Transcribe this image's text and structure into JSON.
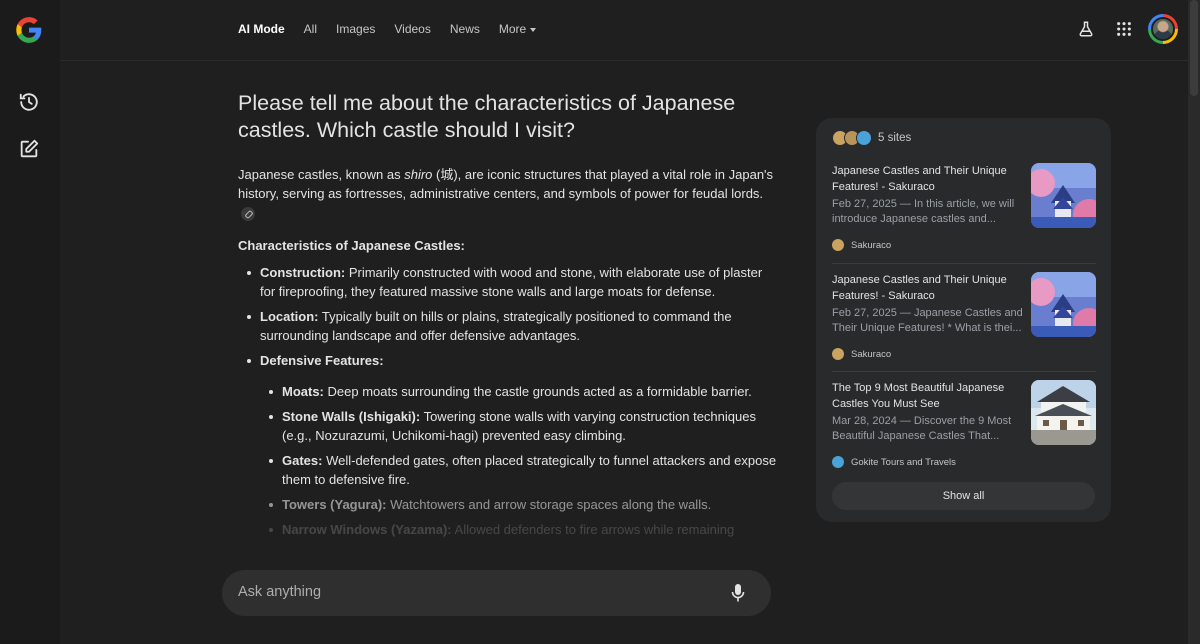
{
  "nav": {
    "tabs": [
      {
        "label": "AI Mode"
      },
      {
        "label": "All"
      },
      {
        "label": "Images"
      },
      {
        "label": "Videos"
      },
      {
        "label": "News"
      },
      {
        "label": "More"
      }
    ],
    "icons": [
      "labs-flask-icon",
      "apps-grid-icon",
      "account-avatar"
    ]
  },
  "sidebar": {
    "icons": [
      "google-logo",
      "history-icon",
      "new-chat-icon"
    ]
  },
  "question": "Please tell me about the characteristics of Japanese castles. Which castle should I visit?",
  "answer": {
    "intro_pre": "Japanese castles, known as ",
    "intro_italic": "shiro",
    "intro_post": " (城), are iconic structures that played a vital role in Japan's history, serving as fortresses, administrative centers, and symbols of power for feudal lords.",
    "section_title": "Characteristics of Japanese Castles:",
    "items": [
      {
        "term": "Construction:",
        "text": " Primarily constructed with wood and stone, with elaborate use of plaster for fireproofing, they featured massive stone walls and large moats for defense."
      },
      {
        "term": "Location:",
        "text": " Typically built on hills or plains, strategically positioned to command the surrounding landscape and offer defensive advantages."
      },
      {
        "term": "Defensive Features:",
        "text": ""
      }
    ],
    "sub_items": [
      {
        "term": "Moats:",
        "text": " Deep moats surrounding the castle grounds acted as a formidable barrier."
      },
      {
        "term": "Stone Walls (Ishigaki):",
        "text": " Towering stone walls with varying construction techniques (e.g., Nozurazumi, Uchikomi-hagi) prevented easy climbing."
      },
      {
        "term": "Gates:",
        "text": " Well-defended gates, often placed strategically to funnel attackers and expose them to defensive fire."
      },
      {
        "term": "Towers (Yagura):",
        "text": " Watchtowers and arrow storage spaces along the walls."
      },
      {
        "term": "Narrow Windows (Yazama):",
        "text": " Allowed defenders to fire arrows while remaining"
      }
    ]
  },
  "ask": {
    "placeholder": "Ask anything"
  },
  "sources": {
    "count_label": "5 sites",
    "items": [
      {
        "title": "Japanese Castles and Their Unique Features! - Sakuraco",
        "snippet": "Feb 27, 2025 — In this article, we will introduce Japanese castles and...",
        "site": "Sakuraco"
      },
      {
        "title": "Japanese Castles and Their Unique Features! - Sakuraco",
        "snippet": "Feb 27, 2025 — Japanese Castles and Their Unique Features! * What is thei...",
        "site": "Sakuraco"
      },
      {
        "title": "The Top 9 Most Beautiful Japanese Castles You Must See",
        "snippet": "Mar 28, 2024 — Discover the 9 Most Beautiful Japanese Castles That...",
        "site": "Gokite Tours and Travels"
      }
    ],
    "show_all": "Show all"
  },
  "colors": {
    "background": "#1f1f1f",
    "card": "#282a2c",
    "text": "#e3e3e3",
    "muted": "#9aa0a6"
  }
}
